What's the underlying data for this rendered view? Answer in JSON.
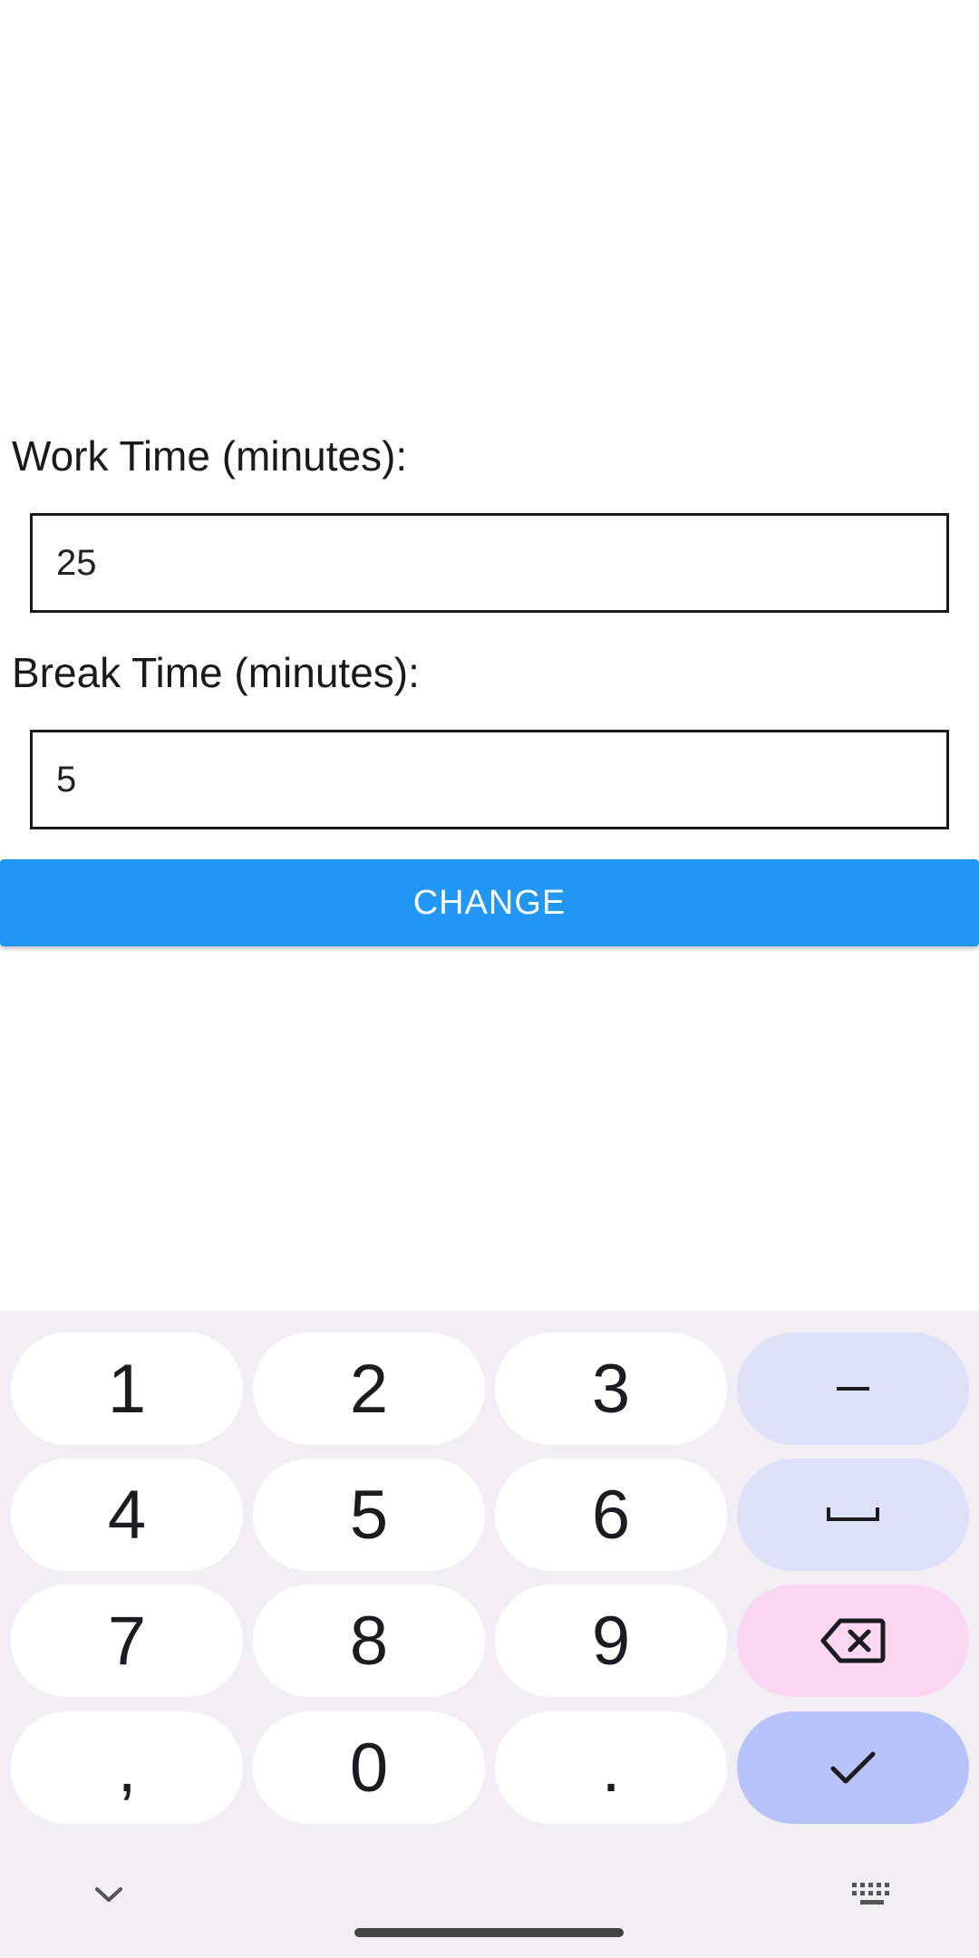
{
  "form": {
    "work_label": "Work Time (minutes):",
    "work_value": "25",
    "break_label": "Break Time (minutes):",
    "break_value": "5",
    "change_button": "CHANGE"
  },
  "keyboard": {
    "keys": [
      "1",
      "2",
      "3",
      "–",
      "4",
      "5",
      "6",
      "␣",
      "7",
      "8",
      "9",
      "backspace",
      ",",
      "0",
      ".",
      "done"
    ],
    "hide_icon": "chevron-down-icon",
    "switch_icon": "keyboard-icon"
  },
  "colors": {
    "accent": "#2196f3",
    "keyboard_bg": "#f2eff4",
    "fn_key": "#dfe0f9",
    "delete_key": "#fbd7f2",
    "done_key": "#b8c3fb"
  }
}
